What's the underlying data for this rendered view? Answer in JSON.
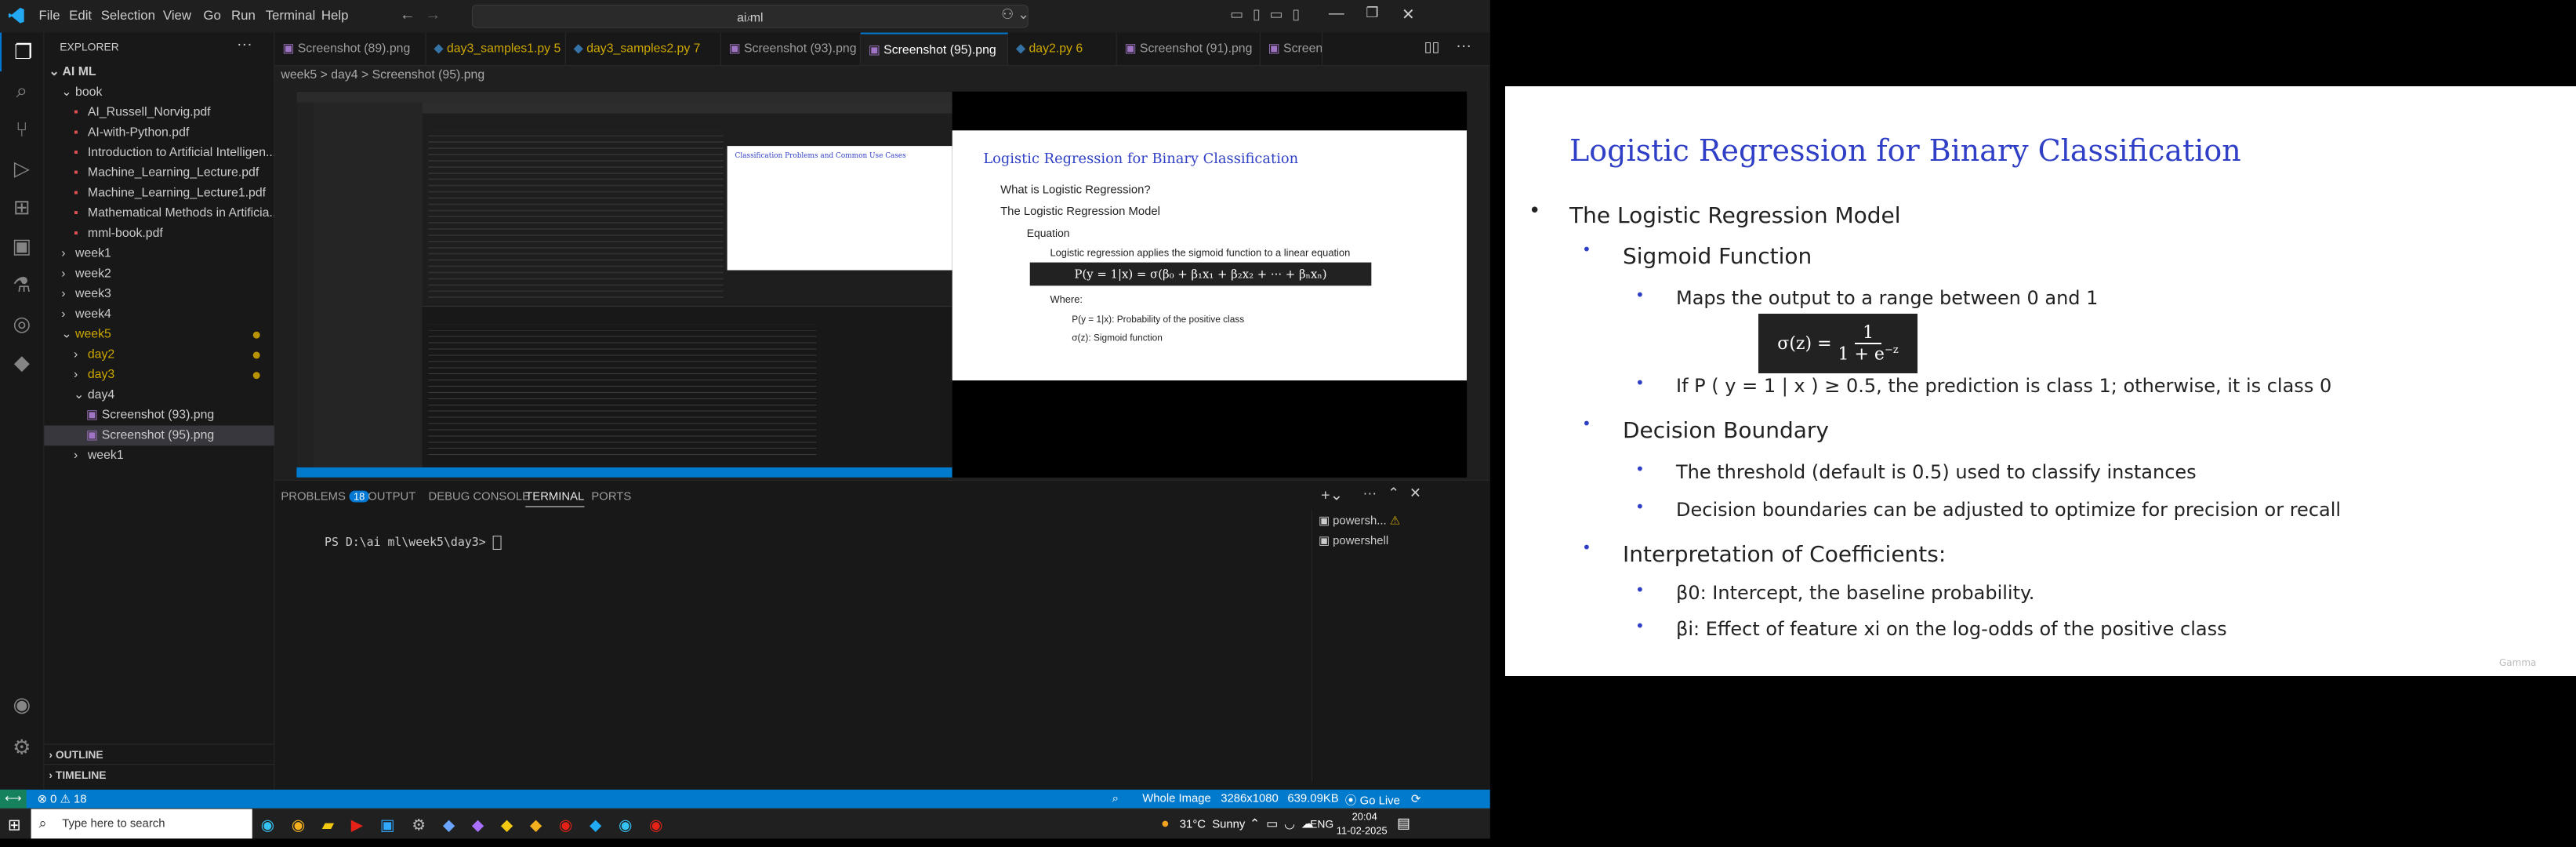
{
  "vscode": {
    "menu": [
      "File",
      "Edit",
      "Selection",
      "View",
      "Go",
      "Run",
      "Terminal",
      "Help"
    ],
    "command_center": "ai ml",
    "explorer": {
      "title": "EXPLORER",
      "root": "AI ML",
      "items": [
        {
          "label": "book",
          "kind": "folder-open",
          "indent": 1
        },
        {
          "label": "AI_Russell_Norvig.pdf",
          "kind": "pdf",
          "indent": 2
        },
        {
          "label": "AI-with-Python.pdf",
          "kind": "pdf",
          "indent": 2
        },
        {
          "label": "Introduction to Artificial Intelligen...",
          "kind": "pdf",
          "indent": 2
        },
        {
          "label": "Machine_Learning_Lecture.pdf",
          "kind": "pdf",
          "indent": 2
        },
        {
          "label": "Machine_Learning_Lecture1.pdf",
          "kind": "pdf",
          "indent": 2
        },
        {
          "label": "Mathematical Methods in Artificia...",
          "kind": "pdf",
          "indent": 2
        },
        {
          "label": "mml-book.pdf",
          "kind": "pdf",
          "indent": 2
        },
        {
          "label": "week1",
          "kind": "folder",
          "indent": 1
        },
        {
          "label": "week2",
          "kind": "folder",
          "indent": 1
        },
        {
          "label": "week3",
          "kind": "folder",
          "indent": 1
        },
        {
          "label": "week4",
          "kind": "folder",
          "indent": 1
        },
        {
          "label": "week5",
          "kind": "folder-open-mod",
          "indent": 1
        },
        {
          "label": "day2",
          "kind": "folder-mod",
          "indent": 2
        },
        {
          "label": "day3",
          "kind": "folder-mod",
          "indent": 2
        },
        {
          "label": "day4",
          "kind": "folder-open",
          "indent": 2
        },
        {
          "label": "Screenshot (93).png",
          "kind": "img",
          "indent": 3
        },
        {
          "label": "Screenshot (95).png",
          "kind": "img-sel",
          "indent": 3
        },
        {
          "label": "week1",
          "kind": "folder",
          "indent": 2
        }
      ],
      "outline": "OUTLINE",
      "timeline": "TIMELINE"
    },
    "tabs": [
      {
        "label": "Screenshot (89).png",
        "state": ""
      },
      {
        "label": "day3_samples1.py 5",
        "state": "mod"
      },
      {
        "label": "day3_samples2.py 7",
        "state": "mod"
      },
      {
        "label": "Screenshot (93).png",
        "state": ""
      },
      {
        "label": "Screenshot (95).png",
        "state": "active"
      },
      {
        "label": "day2.py 6",
        "state": "mod"
      },
      {
        "label": "Screenshot (91).png",
        "state": ""
      },
      {
        "label": "Screen",
        "state": ""
      }
    ],
    "breadcrumb": "week5 > day4 > Screenshot (95).png",
    "panel": {
      "tabs": [
        "PROBLEMS",
        "OUTPUT",
        "DEBUG CONSOLE",
        "TERMINAL",
        "PORTS"
      ],
      "problems_count": "18",
      "prompt": "PS D:\\ai ml\\week5\\day3> ",
      "terminals": [
        "powersh...",
        "powershell"
      ]
    },
    "status": {
      "errors": "0",
      "warnings": "18",
      "image": "Whole Image",
      "dims": "3286x1080",
      "size": "639.09KB",
      "golive": "Go Live"
    },
    "taskbar": {
      "search": "Type here to search",
      "weather": "31°C  Sunny",
      "lang": "ENG",
      "time": "20:04",
      "date": "11-02-2025"
    },
    "mini_slide": {
      "title": "Logistic Regression for Binary Classification",
      "bullets": [
        "What is Logistic Regression?",
        "The Logistic Regression Model",
        "Equation",
        "Logistic regression applies the sigmoid function to a linear equation",
        "P(y = 1|x) = σ(β₀ + β₁x₁ + β₂x₂ + ··· + βₙxₙ)",
        "Where:",
        "P(y = 1|x): Probability of the positive class",
        "σ(z): Sigmoid function"
      ]
    }
  },
  "slide": {
    "title": "Logistic Regression for Binary Classification",
    "items": [
      {
        "text": "The Logistic Regression Model",
        "level": 1
      },
      {
        "text": "Sigmoid Function",
        "level": 2
      },
      {
        "text": "Maps the output to a range between 0 and 1",
        "level": 3
      },
      {
        "text": "If P ( y = 1 | x ) ≥ 0.5, the prediction is class 1; otherwise, it is class 0",
        "level": 3
      },
      {
        "text": "Decision Boundary",
        "level": 2
      },
      {
        "text": "The threshold (default is 0.5) used to classify instances",
        "level": 3
      },
      {
        "text": "Decision boundaries can be adjusted to optimize for precision or recall",
        "level": 3
      },
      {
        "text": "Interpretation of Coefficients:",
        "level": 2
      },
      {
        "text": "β0: Intercept, the baseline probability.",
        "level": 3
      },
      {
        "text": "βi: Effect of feature xi on the log-odds of the positive class",
        "level": 3
      }
    ],
    "formula": "σ(z) = 1 / (1 + e^−z)",
    "watermark": "Gamma"
  }
}
